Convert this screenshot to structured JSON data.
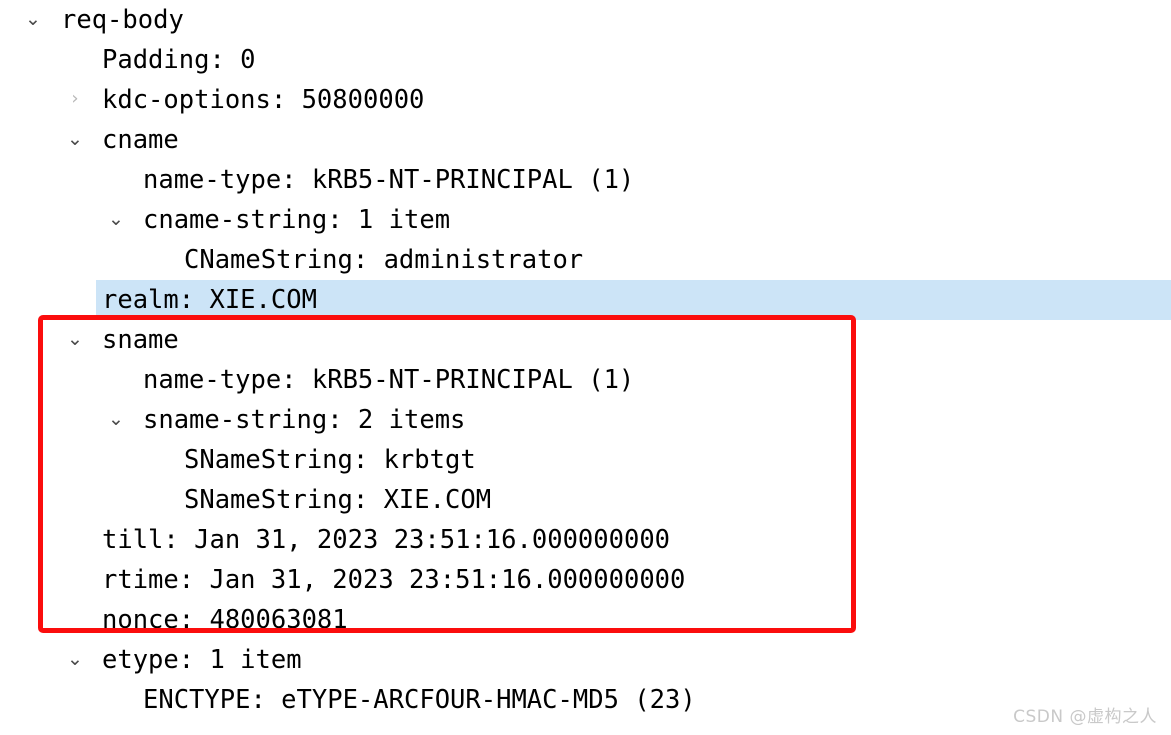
{
  "view": {
    "app": "packet-detail-tree",
    "background": "#ffffff",
    "text_color": "#000000",
    "selection_color": "#cce4f7",
    "annotation_color": "#fb0d0d",
    "watermark_color": "#c9c9c9"
  },
  "icons": {
    "expanded": "⌄",
    "collapsed": "›"
  },
  "tree": {
    "rows": [
      {
        "id": "req-body",
        "level": 0,
        "toggle": "expanded",
        "text": "req-body",
        "selected": false
      },
      {
        "id": "padding",
        "level": 1,
        "toggle": "none",
        "text": "Padding: 0",
        "selected": false
      },
      {
        "id": "kdc-options",
        "level": 1,
        "toggle": "collapsed",
        "text": "kdc-options: 50800000",
        "selected": false
      },
      {
        "id": "cname",
        "level": 1,
        "toggle": "expanded",
        "text": "cname",
        "selected": false
      },
      {
        "id": "cname-nametype",
        "level": 2,
        "toggle": "none",
        "text": "name-type: kRB5-NT-PRINCIPAL (1)",
        "selected": false
      },
      {
        "id": "cname-string",
        "level": 2,
        "toggle": "expanded",
        "text": "cname-string: 1 item",
        "selected": false
      },
      {
        "id": "cnamestring-1",
        "level": 3,
        "toggle": "none",
        "text": "CNameString: administrator",
        "selected": false
      },
      {
        "id": "realm",
        "level": 1,
        "toggle": "none",
        "text": "realm: XIE.COM",
        "selected": true
      },
      {
        "id": "sname",
        "level": 1,
        "toggle": "expanded",
        "text": "sname",
        "selected": false
      },
      {
        "id": "sname-nametype",
        "level": 2,
        "toggle": "none",
        "text": "name-type: kRB5-NT-PRINCIPAL (1)",
        "selected": false
      },
      {
        "id": "sname-string",
        "level": 2,
        "toggle": "expanded",
        "text": "sname-string: 2 items",
        "selected": false
      },
      {
        "id": "snamestring-1",
        "level": 3,
        "toggle": "none",
        "text": "SNameString: krbtgt",
        "selected": false
      },
      {
        "id": "snamestring-2",
        "level": 3,
        "toggle": "none",
        "text": "SNameString: XIE.COM",
        "selected": false
      },
      {
        "id": "till",
        "level": 1,
        "toggle": "none",
        "text": "till: Jan 31, 2023 23:51:16.000000000",
        "selected": false
      },
      {
        "id": "rtime",
        "level": 1,
        "toggle": "none",
        "text": "rtime: Jan 31, 2023 23:51:16.000000000",
        "selected": false
      },
      {
        "id": "nonce",
        "level": 1,
        "toggle": "none",
        "text": "nonce: 480063081",
        "selected": false
      },
      {
        "id": "etype",
        "level": 1,
        "toggle": "expanded",
        "text": "etype: 1 item",
        "selected": false
      },
      {
        "id": "enctype",
        "level": 2,
        "toggle": "none",
        "text": "ENCTYPE: eTYPE-ARCFOUR-HMAC-MD5 (23)",
        "selected": false
      }
    ]
  },
  "annotation": {
    "type": "rectangle-highlight",
    "encloses": [
      "sname",
      "sname-nametype",
      "sname-string",
      "snamestring-1",
      "snamestring-2",
      "till",
      "rtime",
      "nonce"
    ]
  },
  "watermark": {
    "text": "CSDN @虚构之人"
  }
}
